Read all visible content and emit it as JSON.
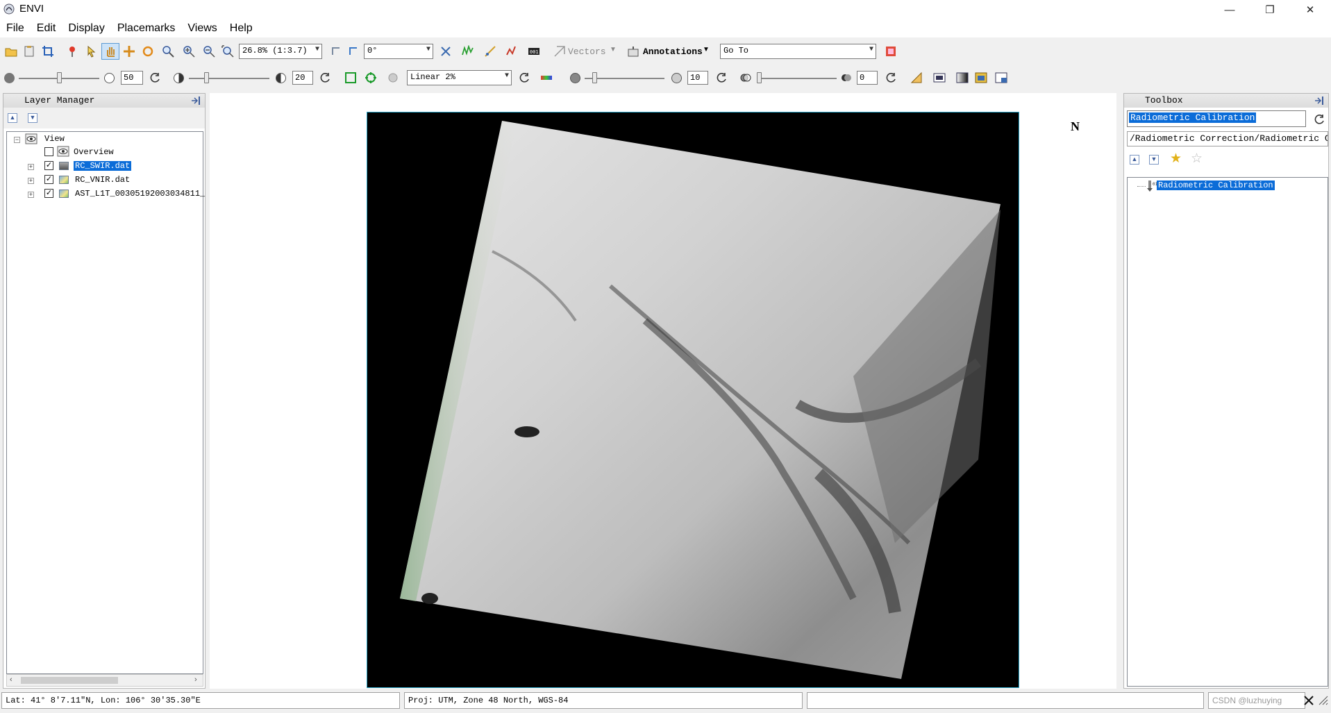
{
  "app": {
    "title": "ENVI"
  },
  "window_controls": {
    "minimize": "—",
    "restore": "❐",
    "close": "✕"
  },
  "menu": [
    "File",
    "Edit",
    "Display",
    "Placemarks",
    "Views",
    "Help"
  ],
  "toolbar1": {
    "zoom_value": "26.8% (1:3.7)",
    "rotation_value": "0°",
    "vectors_label": "Vectors",
    "annotations_label": "Annotations",
    "goto_value": "Go To"
  },
  "toolbar2": {
    "brightness_value": "50",
    "contrast_value": "20",
    "stretch_value": "Linear 2%",
    "sharpen_value": "10",
    "transparency_value": "0",
    "brightness_level": 0.5,
    "contrast_level": 0.2,
    "sharpen_level": 0.1,
    "transparency_level": 0.0
  },
  "layer_manager": {
    "title": "Layer Manager",
    "root_label": "View",
    "items": [
      {
        "label": "Overview",
        "checked": false,
        "selected": false
      },
      {
        "label": "RC_SWIR.dat",
        "checked": true,
        "selected": true
      },
      {
        "label": "RC_VNIR.dat",
        "checked": true,
        "selected": false
      },
      {
        "label": "AST_L1T_00305192003034811_",
        "checked": true,
        "selected": false
      }
    ]
  },
  "toolbox": {
    "title": "Toolbox",
    "search_value": "Radiometric Calibration",
    "path_value": "/Radiometric Correction/Radiometric Cal",
    "result_label": "Radiometric Calibration"
  },
  "north_arrow_label": "N",
  "status": {
    "latlon": "Lat: 41° 8′7.11″N, Lon: 106° 30′35.30″E",
    "proj": "Proj: UTM, Zone 48 North, WGS-84",
    "extra": "",
    "watermark": "CSDN @luzhuying"
  },
  "colors": {
    "selection": "#0b6cd8",
    "image_border": "#2aa7c9",
    "image_bg": "#000000"
  }
}
